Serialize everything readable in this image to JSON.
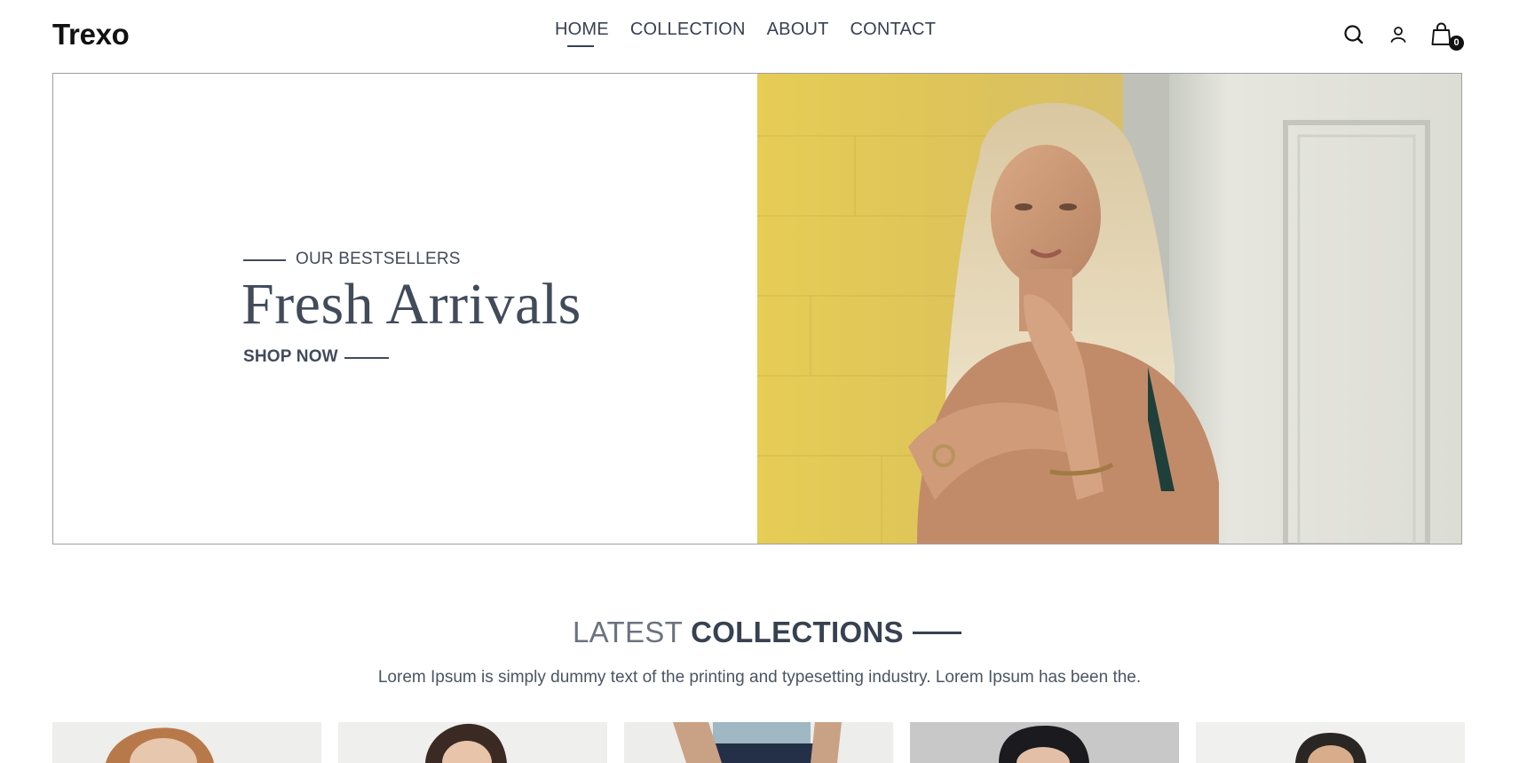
{
  "header": {
    "logo": "Trexo",
    "nav": [
      {
        "label": "HOME",
        "active": true
      },
      {
        "label": "COLLECTION",
        "active": false
      },
      {
        "label": "ABOUT",
        "active": false
      },
      {
        "label": "CONTACT",
        "active": false
      }
    ],
    "cart_count": "0",
    "icons": [
      "search-icon",
      "user-icon",
      "cart-icon"
    ]
  },
  "hero": {
    "eyebrow": "OUR BESTSELLERS",
    "title": "Fresh Arrivals",
    "cta": "SHOP NOW"
  },
  "latest": {
    "title_light": "LATEST",
    "title_bold": "COLLECTIONS",
    "description": "Lorem Ipsum is simply dummy text of the printing and typesetting industry. Lorem Ipsum has been the."
  },
  "colors": {
    "text": "#414b5a",
    "heading": "#374151",
    "hero_border": "#9aa0a6",
    "hero_wall": "#e9cf5a"
  }
}
